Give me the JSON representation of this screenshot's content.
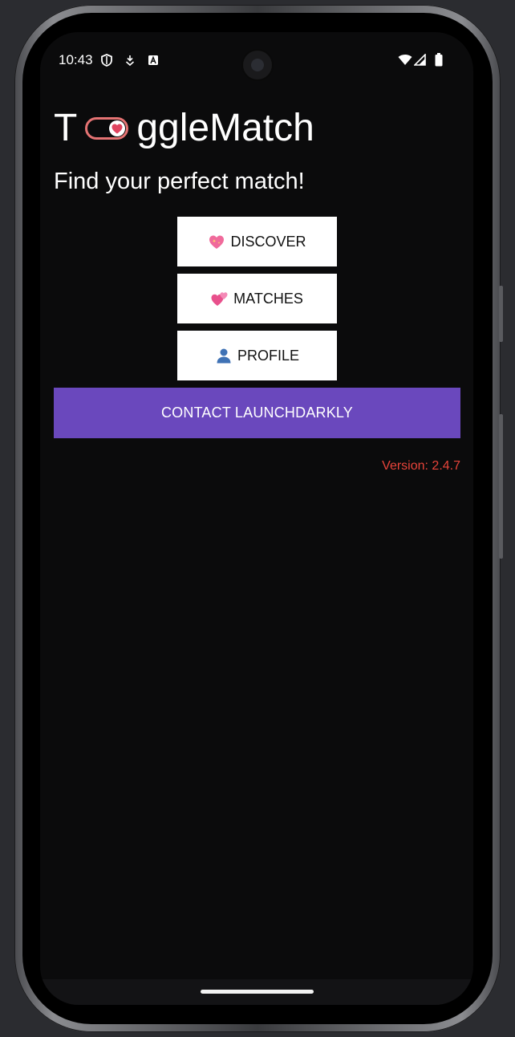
{
  "status_bar": {
    "time": "10:43",
    "left_icons": [
      "shield-icon",
      "download-icon",
      "keyboard-a-icon"
    ],
    "right_icons": [
      "wifi-icon",
      "signal-icon",
      "battery-icon"
    ]
  },
  "app": {
    "title_prefix": "T",
    "title_suffix": "ggleMatch",
    "logo_icon": "toggle-heart-icon",
    "subtitle": "Find your perfect match!"
  },
  "buttons": {
    "discover": {
      "label": "DISCOVER",
      "icon": "sparkling-heart-icon"
    },
    "matches": {
      "label": "MATCHES",
      "icon": "two-hearts-icon"
    },
    "profile": {
      "label": "PROFILE",
      "icon": "person-icon"
    },
    "contact": {
      "label": "CONTACT LAUNCHDARKLY"
    }
  },
  "version_text": "Version: 2.4.7",
  "colors": {
    "background": "#0b0b0c",
    "contact_button": "#6a48bd",
    "version_text": "#e8443a",
    "toggle_outline": "#e57373",
    "heart": "#e0445f"
  }
}
